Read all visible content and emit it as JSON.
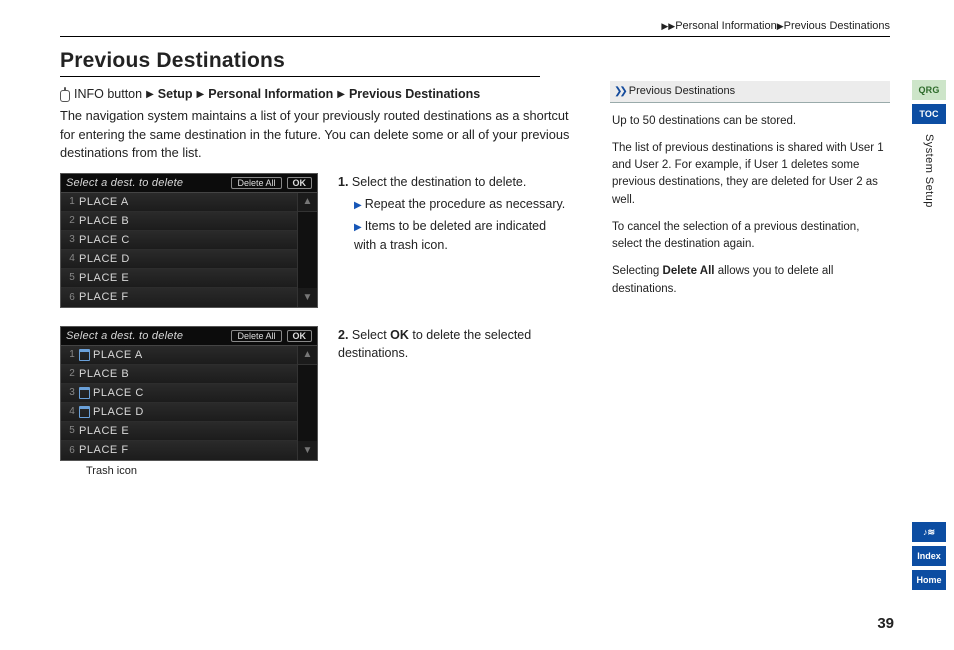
{
  "breadcrumb_top": {
    "a": "Personal Information",
    "b": "Previous Destinations"
  },
  "title": "Previous Destinations",
  "crumb": {
    "info": "INFO button",
    "setup": "Setup",
    "pi": "Personal Information",
    "pd": "Previous Destinations"
  },
  "intro": "The navigation system maintains a list of your previously routed destinations as a shortcut for entering the same destination in the future. You can delete some or all of your previous destinations from the list.",
  "device": {
    "header_title": "Select a dest. to delete",
    "delete_all": "Delete All",
    "ok": "OK",
    "rows1": [
      {
        "idx": "1",
        "name": "PLACE A"
      },
      {
        "idx": "2",
        "name": "PLACE B"
      },
      {
        "idx": "3",
        "name": "PLACE C"
      },
      {
        "idx": "4",
        "name": "PLACE D"
      },
      {
        "idx": "5",
        "name": "PLACE E"
      },
      {
        "idx": "6",
        "name": "PLACE F"
      }
    ],
    "rows2": [
      {
        "idx": "1",
        "name": "PLACE A",
        "trash": true
      },
      {
        "idx": "2",
        "name": "PLACE B"
      },
      {
        "idx": "3",
        "name": "PLACE C",
        "trash": true
      },
      {
        "idx": "4",
        "name": "PLACE D",
        "trash": true
      },
      {
        "idx": "5",
        "name": "PLACE E"
      },
      {
        "idx": "6",
        "name": "PLACE F"
      }
    ]
  },
  "steps": {
    "s1": "Select the destination to delete.",
    "s1a": "Repeat the procedure as necessary.",
    "s1b": "Items to be deleted are indicated with a trash icon.",
    "s2a": "Select ",
    "s2b": "OK",
    "s2c": " to delete the selected destinations."
  },
  "trash_label": "Trash icon",
  "sidebar": {
    "heading": "Previous Destinations",
    "p1": "Up to 50 destinations can be stored.",
    "p2": "The list of previous destinations is shared with User 1 and User 2. For example, if User 1 deletes some previous destinations, they are deleted for User 2 as well.",
    "p3": "To cancel the selection of a previous destination, select the destination again.",
    "p4a": "Selecting ",
    "p4b": "Delete All",
    "p4c": " allows you to delete all destinations."
  },
  "rail": {
    "qrg": "QRG",
    "toc": "TOC",
    "section": "System Setup",
    "voice": "♪≋",
    "index": "Index",
    "home": "Home"
  },
  "page_number": "39"
}
